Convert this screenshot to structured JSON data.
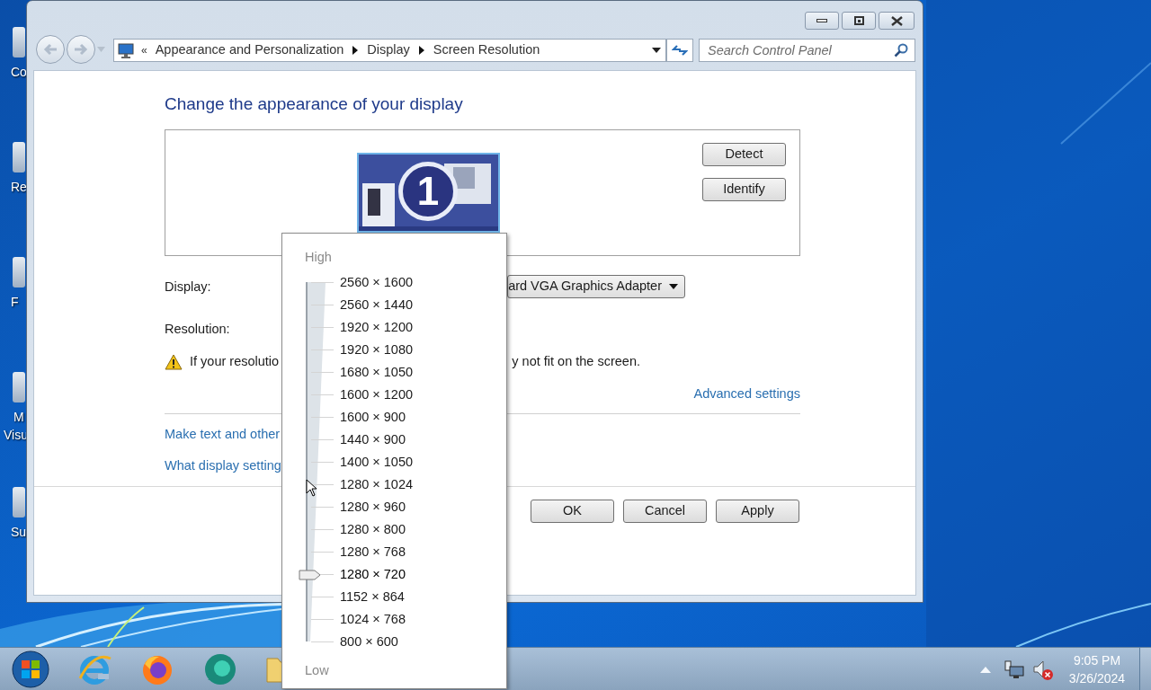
{
  "desktop_icons": [
    {
      "lines": [
        "Co"
      ]
    },
    {
      "lines": [
        "Re"
      ]
    },
    {
      "lines": [
        "F"
      ]
    },
    {
      "lines": [
        "M",
        "Visu"
      ]
    },
    {
      "lines": [
        "Su"
      ]
    }
  ],
  "window": {
    "address_prefix": "«",
    "breadcrumb": [
      "Appearance and Personalization",
      "Display",
      "Screen Resolution"
    ],
    "search": {
      "placeholder": "Search Control Panel"
    },
    "heading": "Change the appearance of your display",
    "monitor_number": "1",
    "side_buttons": [
      "Detect",
      "Identify"
    ],
    "display_label": "Display:",
    "display_value": "ard VGA Graphics Adapter",
    "resolution_label": "Resolution:",
    "warning": [
      "If your resolutio",
      "y not fit on the screen."
    ],
    "advanced_link": "Advanced settings",
    "links": [
      "Make text and other",
      "What display setting"
    ],
    "footer_buttons": [
      "OK",
      "Cancel",
      "Apply"
    ]
  },
  "resolution_popup": {
    "high_label": "High",
    "low_label": "Low",
    "options": [
      {
        "label": "2560 × 1600",
        "selected": false
      },
      {
        "label": "2560 × 1440",
        "selected": false
      },
      {
        "label": "1920 × 1200",
        "selected": false
      },
      {
        "label": "1920 × 1080",
        "selected": false
      },
      {
        "label": "1680 × 1050",
        "selected": false
      },
      {
        "label": "1600 × 1200",
        "selected": false
      },
      {
        "label": "1600 × 900",
        "selected": false
      },
      {
        "label": "1440 × 900",
        "selected": false
      },
      {
        "label": "1400 × 1050",
        "selected": false
      },
      {
        "label": "1280 × 1024",
        "selected": false
      },
      {
        "label": "1280 × 960",
        "selected": false
      },
      {
        "label": "1280 × 800",
        "selected": false
      },
      {
        "label": "1280 × 768",
        "selected": false
      },
      {
        "label": "1280 × 720",
        "selected": true
      },
      {
        "label": "1152 × 864",
        "selected": false
      },
      {
        "label": "1024 × 768",
        "selected": false
      },
      {
        "label": "800 × 600",
        "selected": false
      }
    ]
  },
  "taskbar": {
    "time": "9:05 PM",
    "date": "3/26/2024"
  }
}
